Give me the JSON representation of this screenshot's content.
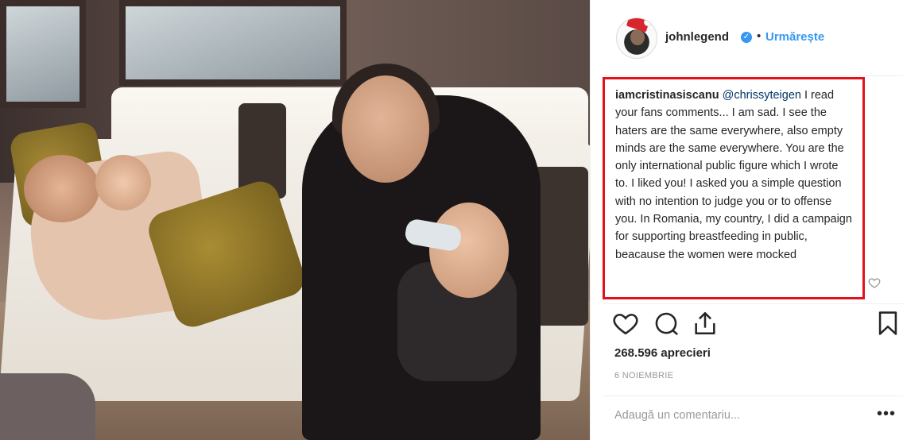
{
  "post": {
    "username": "johnlegend",
    "verified_icon": "verified-badge-icon",
    "dot": "•",
    "follow_label": "Urmărește"
  },
  "comment": {
    "user": "iamcristinasiscanu",
    "mention": "@chrissyteigen",
    "text": " I read your fans comments... I am sad. I see the haters are the same everywhere, also empty minds are the same everywhere. You are the only international public figure which I wrote to. I liked you! I asked you a simple question with no intention to judge you or to offense you. In Romania, my country, I did a campaign for supporting breastfeeding in public, beacause the women were mocked"
  },
  "stats": {
    "likes": "268.596 aprecieri",
    "date": "6 NOIEMBRIE"
  },
  "footer": {
    "add_comment_placeholder": "Adaugă un comentariu...",
    "more": "•••"
  },
  "colors": {
    "highlight_border": "#e0131d",
    "link_blue": "#3897f0"
  }
}
